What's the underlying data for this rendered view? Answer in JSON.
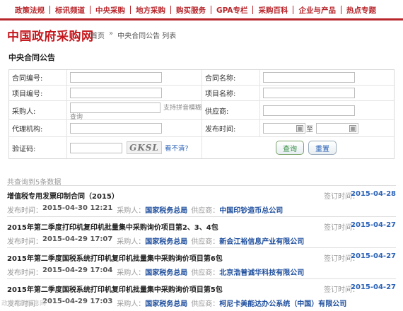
{
  "nav": {
    "items": [
      "政策法规",
      "标讯频道",
      "中央采购",
      "地方采购",
      "购买服务",
      "GPA专栏",
      "采购百科",
      "企业与产品",
      "热点专题"
    ]
  },
  "header": {
    "logo": "中国政府采购网",
    "breadcrumb_home": "首页",
    "breadcrumb_arrow": "»",
    "breadcrumb_current": "中央合同公告  列表"
  },
  "page_title": "中央合同公告",
  "form": {
    "contract_no_label": "合同编号:",
    "contract_name_label": "合同名称:",
    "project_no_label": "项目编号:",
    "project_name_label": "项目名称:",
    "purchaser_label": "采购人:",
    "purchaser_hint": "支持拼音模糊",
    "purchaser_hint2": "查询",
    "supplier_label": "供应商:",
    "agency_label": "代理机构:",
    "publish_time_label": "发布时间:",
    "to_label": "至",
    "captcha_label": "验证码:",
    "captcha_text": "GKSL",
    "refresh_text": "看不清?",
    "query_button": "查询",
    "reset_button": "重置"
  },
  "results_count": "共查询到5条数据",
  "results": [
    {
      "title": "增值税专用发票印制合同（2015）",
      "sign_label": "签订时间：",
      "sign_date": "2015-04-28",
      "publish_label": "发布时间：",
      "publish_time": "2015-04-30 12:21",
      "purchaser_label": "采购人：",
      "purchaser": "国家税务总局",
      "supplier_label": "供应商：",
      "supplier": "中国印钞造币总公司"
    },
    {
      "title": "2015年第二季度打印机复印机批量集中采购询价项目第2、3、4包",
      "sign_label": "签订时间：",
      "sign_date": "2015-04-27",
      "publish_label": "发布时间：",
      "publish_time": "2015-04-29 17:07",
      "purchaser_label": "采购人：",
      "purchaser": "国家税务总局",
      "supplier_label": "供应商：",
      "supplier": "新会江裕信息产业有限公司"
    },
    {
      "title": "2015年第二季度国税系统打印机复印机批量集中采购询价项目第6包",
      "sign_label": "签订时间：",
      "sign_date": "2015-04-27",
      "publish_label": "发布时间：",
      "publish_time": "2015-04-29 17:04",
      "purchaser_label": "采购人：",
      "purchaser": "国家税务总局",
      "supplier_label": "供应商：",
      "supplier": "北京浩普诚华科技有限公司"
    },
    {
      "title": "2015年第二季度国税系统打印机复印机批量集中采购询价项目第5包",
      "sign_label": "签订时间：",
      "sign_date": "2015-04-27",
      "publish_label": "发布时间：",
      "publish_time": "2015-04-29 17:03",
      "purchaser_label": "采购人：",
      "purchaser": "国家税务总局",
      "supplier_label": "供应商：",
      "supplier": "柯尼卡美能达办公系统（中国）有限公司"
    }
  ],
  "watermark": "政府采购信息网",
  "colors": {
    "brand_red": "#b8262b",
    "link_blue": "#2c63b8"
  }
}
